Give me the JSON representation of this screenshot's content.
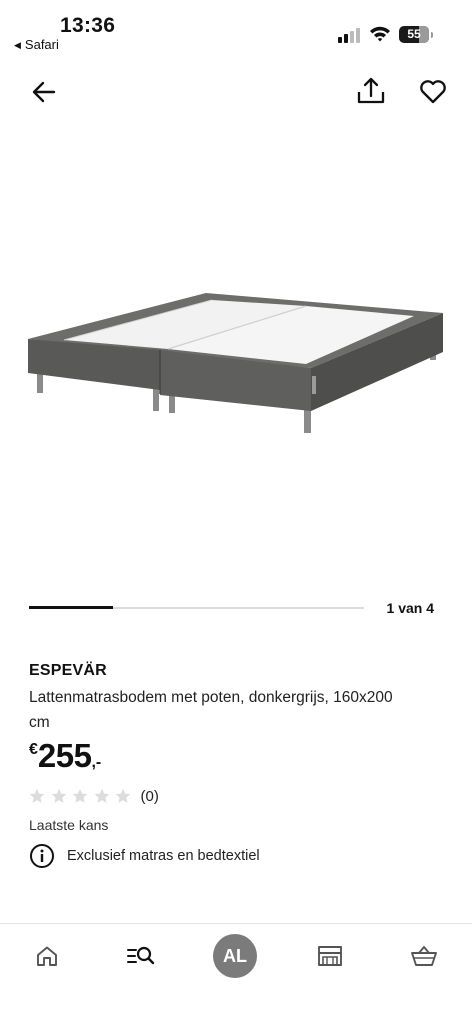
{
  "status_bar": {
    "time": "13:36",
    "back_app": "Safari",
    "battery": "55"
  },
  "nav": {
    "back_icon": "arrow-left-icon",
    "share_icon": "share-icon",
    "favorite_icon": "heart-icon"
  },
  "gallery": {
    "counter": "1 van 4",
    "current": 1,
    "total": 4
  },
  "product": {
    "name": "ESPEVÄR",
    "description": "Lattenmatrasbodem met poten, donkergrijs, 160x200 cm",
    "price_currency": "€",
    "price_main": "255",
    "price_decimals": ",-",
    "rating_stars": 0,
    "rating_max": 5,
    "rating_count": "(0)",
    "availability": "Laatste kans",
    "info_text": "Exclusief matras en bedtextiel"
  },
  "tabbar": {
    "items": [
      {
        "name": "home",
        "icon": "home-icon"
      },
      {
        "name": "search",
        "icon": "search-icon"
      },
      {
        "name": "account",
        "label": "AL"
      },
      {
        "name": "store",
        "icon": "store-icon"
      },
      {
        "name": "basket",
        "icon": "basket-icon"
      }
    ]
  },
  "colors": {
    "text": "#111111",
    "star_empty": "#dcdcdc",
    "avatar_bg": "#7b7b7b",
    "product_grey": "#5f605d"
  }
}
